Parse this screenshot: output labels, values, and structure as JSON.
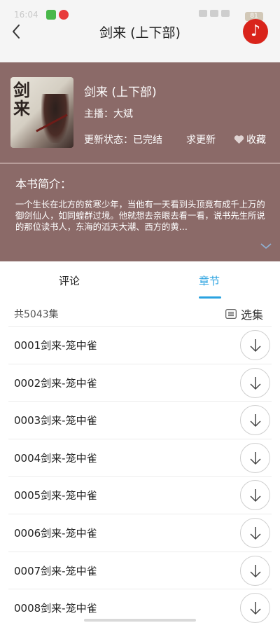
{
  "status_bar": {
    "time": "16:04",
    "battery": "81"
  },
  "header": {
    "title": "剑来 (上下部)"
  },
  "book": {
    "title": "剑来 (上下部)",
    "anchor": "主播：大斌",
    "status": "更新状态：已完结",
    "request_update": "求更新",
    "favorite": "收藏",
    "intro_heading": "本书简介：",
    "intro_text": "一个生长在北方的贫寒少年，当他有一天看到头顶竟有成千上万的御剑仙人，如同蝗群过境。他就想去亲眼去看一看，说书先生所说的那位读书人，东海的滔天大潮、西方的黄…",
    "cover_text": "剑来"
  },
  "tabs": [
    {
      "label": "评论"
    },
    {
      "label": "章节"
    }
  ],
  "chapters": {
    "count": "共5043集",
    "select_label": "选集",
    "items": [
      {
        "label": "0001剑来-笼中雀"
      },
      {
        "label": "0002剑来-笼中雀"
      },
      {
        "label": "0003剑来-笼中雀"
      },
      {
        "label": "0004剑来-笼中雀"
      },
      {
        "label": "0005剑来-笼中雀"
      },
      {
        "label": "0006剑来-笼中雀"
      },
      {
        "label": "0007剑来-笼中雀"
      },
      {
        "label": "0008剑来-笼中雀"
      }
    ]
  },
  "colors": {
    "banner": "#8b6a68",
    "accent": "#2aa2e0",
    "music": "#d9241b"
  },
  "icons": {
    "back": "back-arrow-icon",
    "music": "music-note-icon",
    "favorite": "heart-icon",
    "select": "list-icon",
    "download": "download-arrow-icon",
    "expand": "chevron-down-icon"
  }
}
